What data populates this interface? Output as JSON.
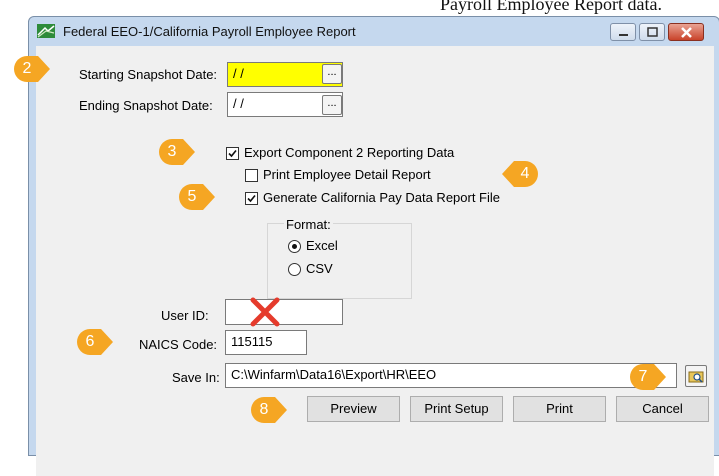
{
  "background_caption": "Payroll Employee Report data.",
  "window": {
    "title": "Federal EEO-1/California Payroll Employee Report"
  },
  "form": {
    "starting_snapshot_label": "Starting Snapshot Date:",
    "starting_snapshot_value": "/ /",
    "ending_snapshot_label": "Ending Snapshot Date:",
    "ending_snapshot_value": "/ /",
    "browse_label": "...",
    "export_component2_label": "Export Component 2 Reporting Data",
    "export_component2_checked": true,
    "print_detail_label": "Print Employee Detail Report",
    "print_detail_checked": false,
    "generate_ca_label": "Generate California Pay Data Report File",
    "generate_ca_checked": true,
    "format_label": "Format:",
    "format_options": [
      "Excel",
      "CSV"
    ],
    "format_selected": "Excel",
    "user_id_label": "User ID:",
    "user_id_value": "",
    "naics_label": "NAICS Code:",
    "naics_value": "115115",
    "save_in_label": "Save In:",
    "save_in_value": "C:\\Winfarm\\Data16\\Export\\HR\\EEO"
  },
  "buttons": {
    "preview": "Preview",
    "print_setup": "Print Setup",
    "print": "Print",
    "cancel": "Cancel"
  },
  "callouts": [
    "2",
    "3",
    "4",
    "5",
    "6",
    "7",
    "8"
  ],
  "colors": {
    "callout": "#f5a623",
    "highlight_field": "#ffff00",
    "red_x": "#e53b2c"
  }
}
